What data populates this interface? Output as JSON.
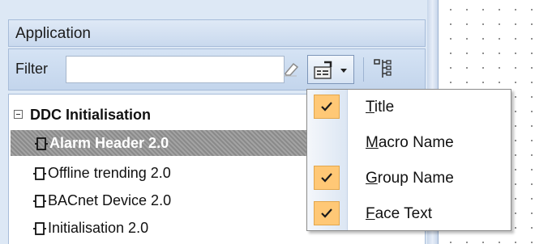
{
  "panel": {
    "title": "Application"
  },
  "toolbar": {
    "filter_label": "Filter",
    "filter_value": "",
    "icons": [
      "eraser-icon",
      "properties-icon",
      "tree-layout-icon"
    ]
  },
  "tree": {
    "root_label": "DDC Initialisation",
    "items": [
      {
        "label": "Alarm Header 2.0",
        "selected": true
      },
      {
        "label": "Offline trending 2.0",
        "selected": false
      },
      {
        "label": "BACnet Device 2.0",
        "selected": false
      },
      {
        "label": "Initialisation 2.0",
        "selected": false
      }
    ]
  },
  "menu": {
    "items": [
      {
        "label": "Title",
        "mnemonic": "T",
        "rest": "itle",
        "checked": true
      },
      {
        "label": "Macro Name",
        "mnemonic": "M",
        "rest": "acro Name",
        "checked": false
      },
      {
        "label": "Group Name",
        "mnemonic": "G",
        "rest": "roup Name",
        "checked": true
      },
      {
        "label": "Face Text",
        "mnemonic": "F",
        "rest": "ace Text",
        "checked": true
      }
    ]
  },
  "colors": {
    "check_bg": "#ffc876",
    "panel_bg": "#dde8f5",
    "selection": "#9a9a9a"
  }
}
